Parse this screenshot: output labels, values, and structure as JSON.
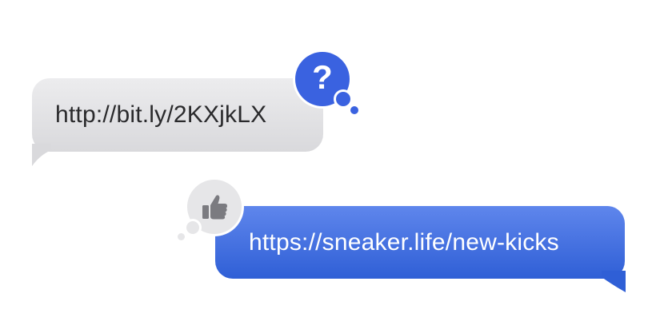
{
  "conversation": {
    "incoming_message": {
      "text": "http://bit.ly/2KXjkLX",
      "tapback": {
        "icon": "question-mark-icon",
        "glyph": "?",
        "color": "#3a62e0"
      }
    },
    "outgoing_message": {
      "text": "https://sneaker.life/new-kicks",
      "tapback": {
        "icon": "thumbs-up-icon",
        "color": "#e6e6e8"
      }
    }
  },
  "colors": {
    "incoming_bubble": "#e3e3e5",
    "outgoing_bubble": "#3a68e0",
    "incoming_text": "#2a2a2c",
    "outgoing_text": "#ffffff"
  }
}
